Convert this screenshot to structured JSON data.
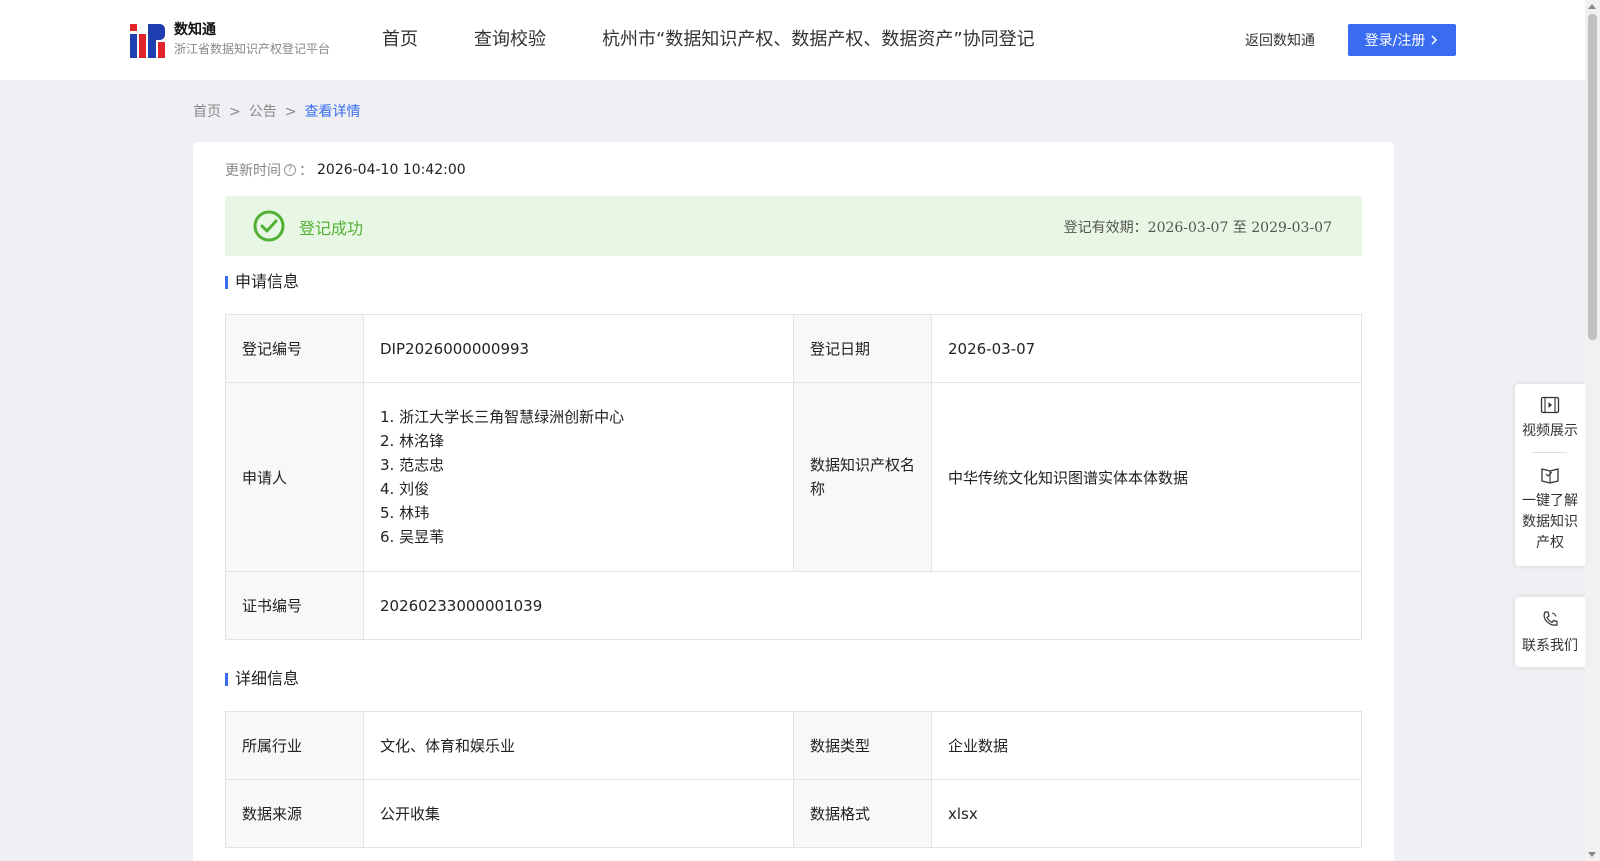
{
  "header": {
    "logo_title": "数知通",
    "logo_subtitle": "浙江省数据知识产权登记平台",
    "nav": [
      "首页",
      "查询校验",
      "杭州市“数据知识产权、数据产权、数据资产”协同登记"
    ],
    "back_link": "返回数知通",
    "login_label": "登录/注册"
  },
  "breadcrumb": {
    "home": "首页",
    "sep": ">",
    "notice": "公告",
    "current": "查看详情"
  },
  "update": {
    "label": "更新时间",
    "colon": "：",
    "value": "2026-04-10 10:42:00"
  },
  "status": {
    "text": "登记成功",
    "validity_label": "登记有效期：",
    "validity_value": "2026-03-07 至 2029-03-07",
    "color": "#52b135"
  },
  "application": {
    "title": "申请信息",
    "reg_no_label": "登记编号",
    "reg_no": "DIP2026000000993",
    "reg_date_label": "登记日期",
    "reg_date": "2026-03-07",
    "applicant_label": "申请人",
    "applicants": [
      "1. 浙江大学长三角智慧绿洲创新中心",
      "2. 林洺锋",
      "3. 范志忠",
      "4. 刘俊",
      "5. 林玮",
      "6. 吴昱苇"
    ],
    "ip_name_label": "数据知识产权名称",
    "ip_name": "中华传统文化知识图谱实体本体数据",
    "cert_no_label": "证书编号",
    "cert_no": "20260233000001039"
  },
  "details": {
    "title": "详细信息",
    "industry_label": "所属行业",
    "industry": "文化、体育和娱乐业",
    "data_type_label": "数据类型",
    "data_type": "企业数据",
    "source_label": "数据来源",
    "source": "公开收集",
    "format_label": "数据格式",
    "format": "xlsx"
  },
  "float_panel": {
    "video": "视频展示",
    "learn": "一键了解数据知识产权",
    "contact": "联系我们"
  },
  "colors": {
    "accent": "#3a6cf2",
    "success_bg": "#e8f6e4"
  }
}
